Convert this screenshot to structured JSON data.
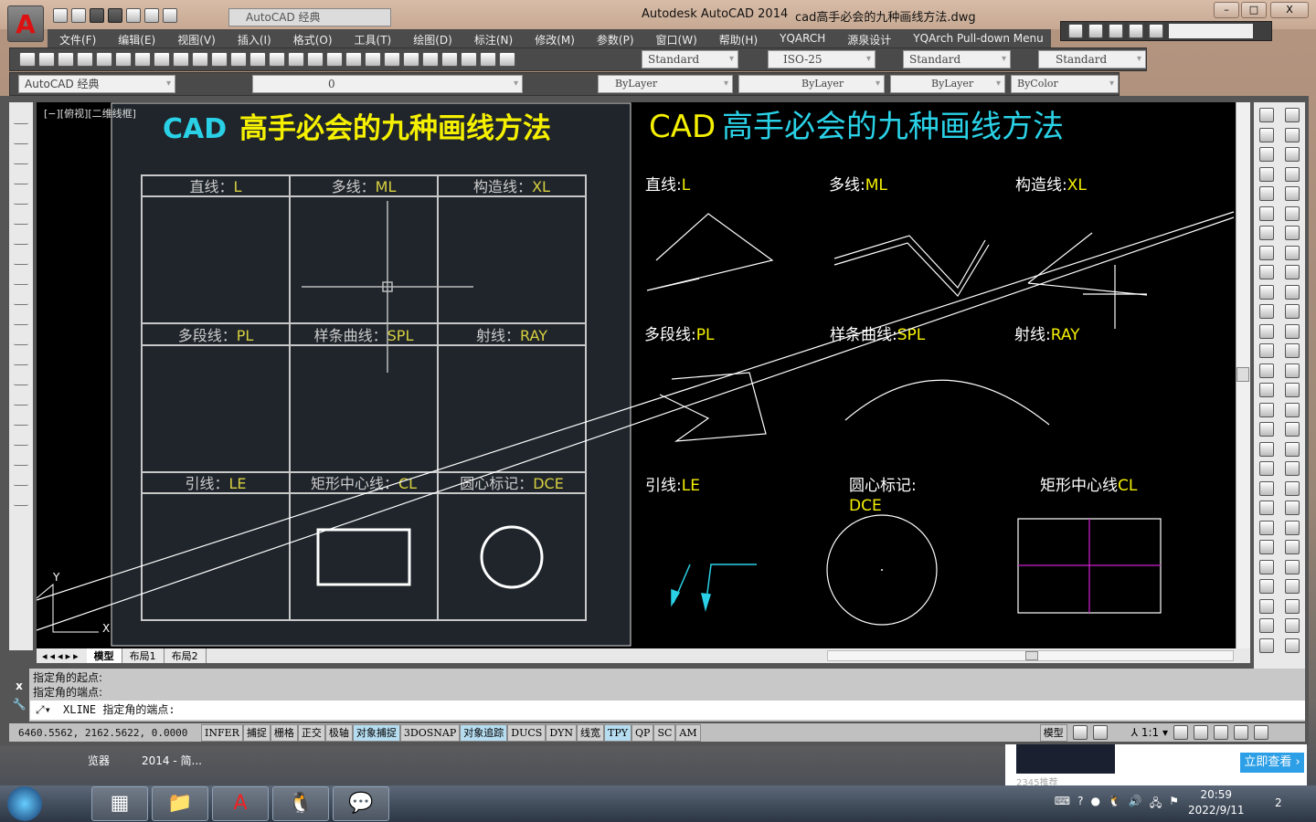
{
  "window": {
    "app_title": "Autodesk AutoCAD 2014",
    "doc_title": "cad高手必会的九种画线方法.dwg",
    "workspace": "AutoCAD 经典",
    "minimize": "–",
    "maximize": "□",
    "close": "X"
  },
  "menu": [
    "文件(F)",
    "编辑(E)",
    "视图(V)",
    "插入(I)",
    "格式(O)",
    "工具(T)",
    "绘图(D)",
    "标注(N)",
    "修改(M)",
    "参数(P)",
    "窗口(W)",
    "帮助(H)",
    "YQARCH",
    "源泉设计",
    "YQArch Pull-down Menu"
  ],
  "styles": {
    "text_style": "Standard",
    "dim_style": "ISO-25",
    "table_style": "Standard",
    "mleader_style": "Standard"
  },
  "layers": {
    "workspace": "AutoCAD 经典",
    "current_layer": "0",
    "color": "ByLayer",
    "linetype": "ByLayer",
    "lineweight": "ByLayer",
    "plotstyle": "ByColor"
  },
  "viewport_label": "[−][俯视][二维线框]",
  "drawing": {
    "left_title_a": "CAD",
    "left_title_b": "高手必会的九种画线方法",
    "left_cells": [
      [
        "直线：",
        "L"
      ],
      [
        "多线：",
        "ML"
      ],
      [
        "构造线：",
        "XL"
      ],
      [
        "多段线：",
        "PL"
      ],
      [
        "样条曲线：",
        "SPL"
      ],
      [
        "射线：",
        "RAY"
      ],
      [
        "引线：",
        "LE"
      ],
      [
        "矩形中心线：",
        "CL"
      ],
      [
        "圆心标记：",
        "DCE"
      ]
    ],
    "right_title_a": "CAD",
    "right_title_b": "高手必会的九种画线方法",
    "right_labels": [
      [
        "直线:",
        "L"
      ],
      [
        "多线:",
        "ML"
      ],
      [
        "构造线:",
        "XL"
      ],
      [
        "多段线:",
        "PL"
      ],
      [
        "样条曲线:",
        "SPL"
      ],
      [
        "射线:",
        "RAY"
      ],
      [
        "引线:",
        "LE"
      ],
      [
        "圆心标记:",
        "DCE"
      ],
      [
        "矩形中心线",
        "CL"
      ]
    ],
    "ucs_y": "Y",
    "ucs_x": "X"
  },
  "layout_tabs": [
    "模型",
    "布局1",
    "布局2"
  ],
  "command": {
    "history": [
      "指定角的起点:",
      "指定角的端点:"
    ],
    "prompt": "XLINE 指定角的端点:"
  },
  "status": {
    "coords": "6460.5562, 2162.5622, 0.0000",
    "toggles": [
      {
        "label": "INFER",
        "on": false
      },
      {
        "label": "捕捉",
        "on": false
      },
      {
        "label": "栅格",
        "on": false
      },
      {
        "label": "正交",
        "on": false
      },
      {
        "label": "极轴",
        "on": false
      },
      {
        "label": "对象捕捉",
        "on": true
      },
      {
        "label": "3DOSNAP",
        "on": false
      },
      {
        "label": "对象追踪",
        "on": true
      },
      {
        "label": "DUCS",
        "on": false
      },
      {
        "label": "DYN",
        "on": false
      },
      {
        "label": "线宽",
        "on": false
      },
      {
        "label": "TPY",
        "on": true
      },
      {
        "label": "QP",
        "on": false
      },
      {
        "label": "SC",
        "on": false
      },
      {
        "label": "AM",
        "on": false
      }
    ],
    "model": "模型",
    "scale": "1:1"
  },
  "desktop": {
    "icon_label_1": "览器",
    "icon_label_2": "2014 - 简...",
    "ad_source": "2345推荐",
    "ad_button": "立即查看 ›"
  },
  "taskbar": {
    "time": "20:59",
    "date": "2022/9/11",
    "notifications": "2",
    "apps": [
      "start-icon",
      "2345-browser-icon",
      "file-explorer-icon",
      "autocad-icon",
      "qq-icon",
      "wechat-icon"
    ]
  },
  "colors": {
    "yellow": "#f5f000",
    "cyan": "#2ad1e6",
    "magenta": "#d020d0",
    "canvas": "#000000",
    "panel": "#1f252b"
  }
}
